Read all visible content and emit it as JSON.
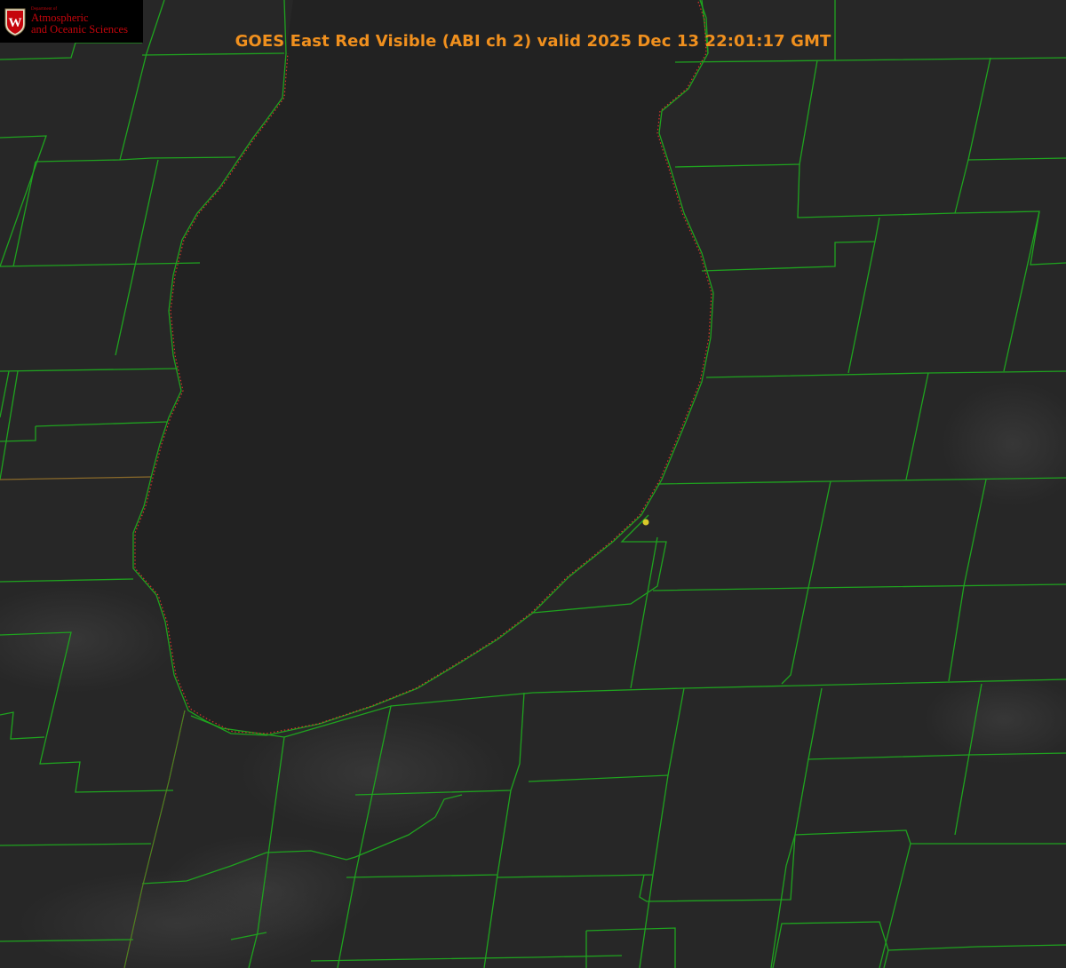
{
  "title": "GOES East Red Visible (ABI ch 2) valid 2025 Dec 13 22:01:17 GMT",
  "logo": {
    "department": "Department of",
    "line1": "Atmospheric",
    "line2": "and Oceanic Sciences",
    "letter": "W"
  },
  "colors": {
    "background": "#262626",
    "lake": "#232323",
    "county_lines": "#1fa31f",
    "state_line": "#c0302a",
    "shoreline_dots": "#d8342c",
    "title": "#f0901e",
    "logo_red": "#c5050c",
    "marker": "#d9c92a"
  },
  "layers": [
    "satellite-visible-imagery",
    "county-boundaries",
    "state-boundary",
    "lake-michigan-shoreline",
    "point-marker"
  ]
}
